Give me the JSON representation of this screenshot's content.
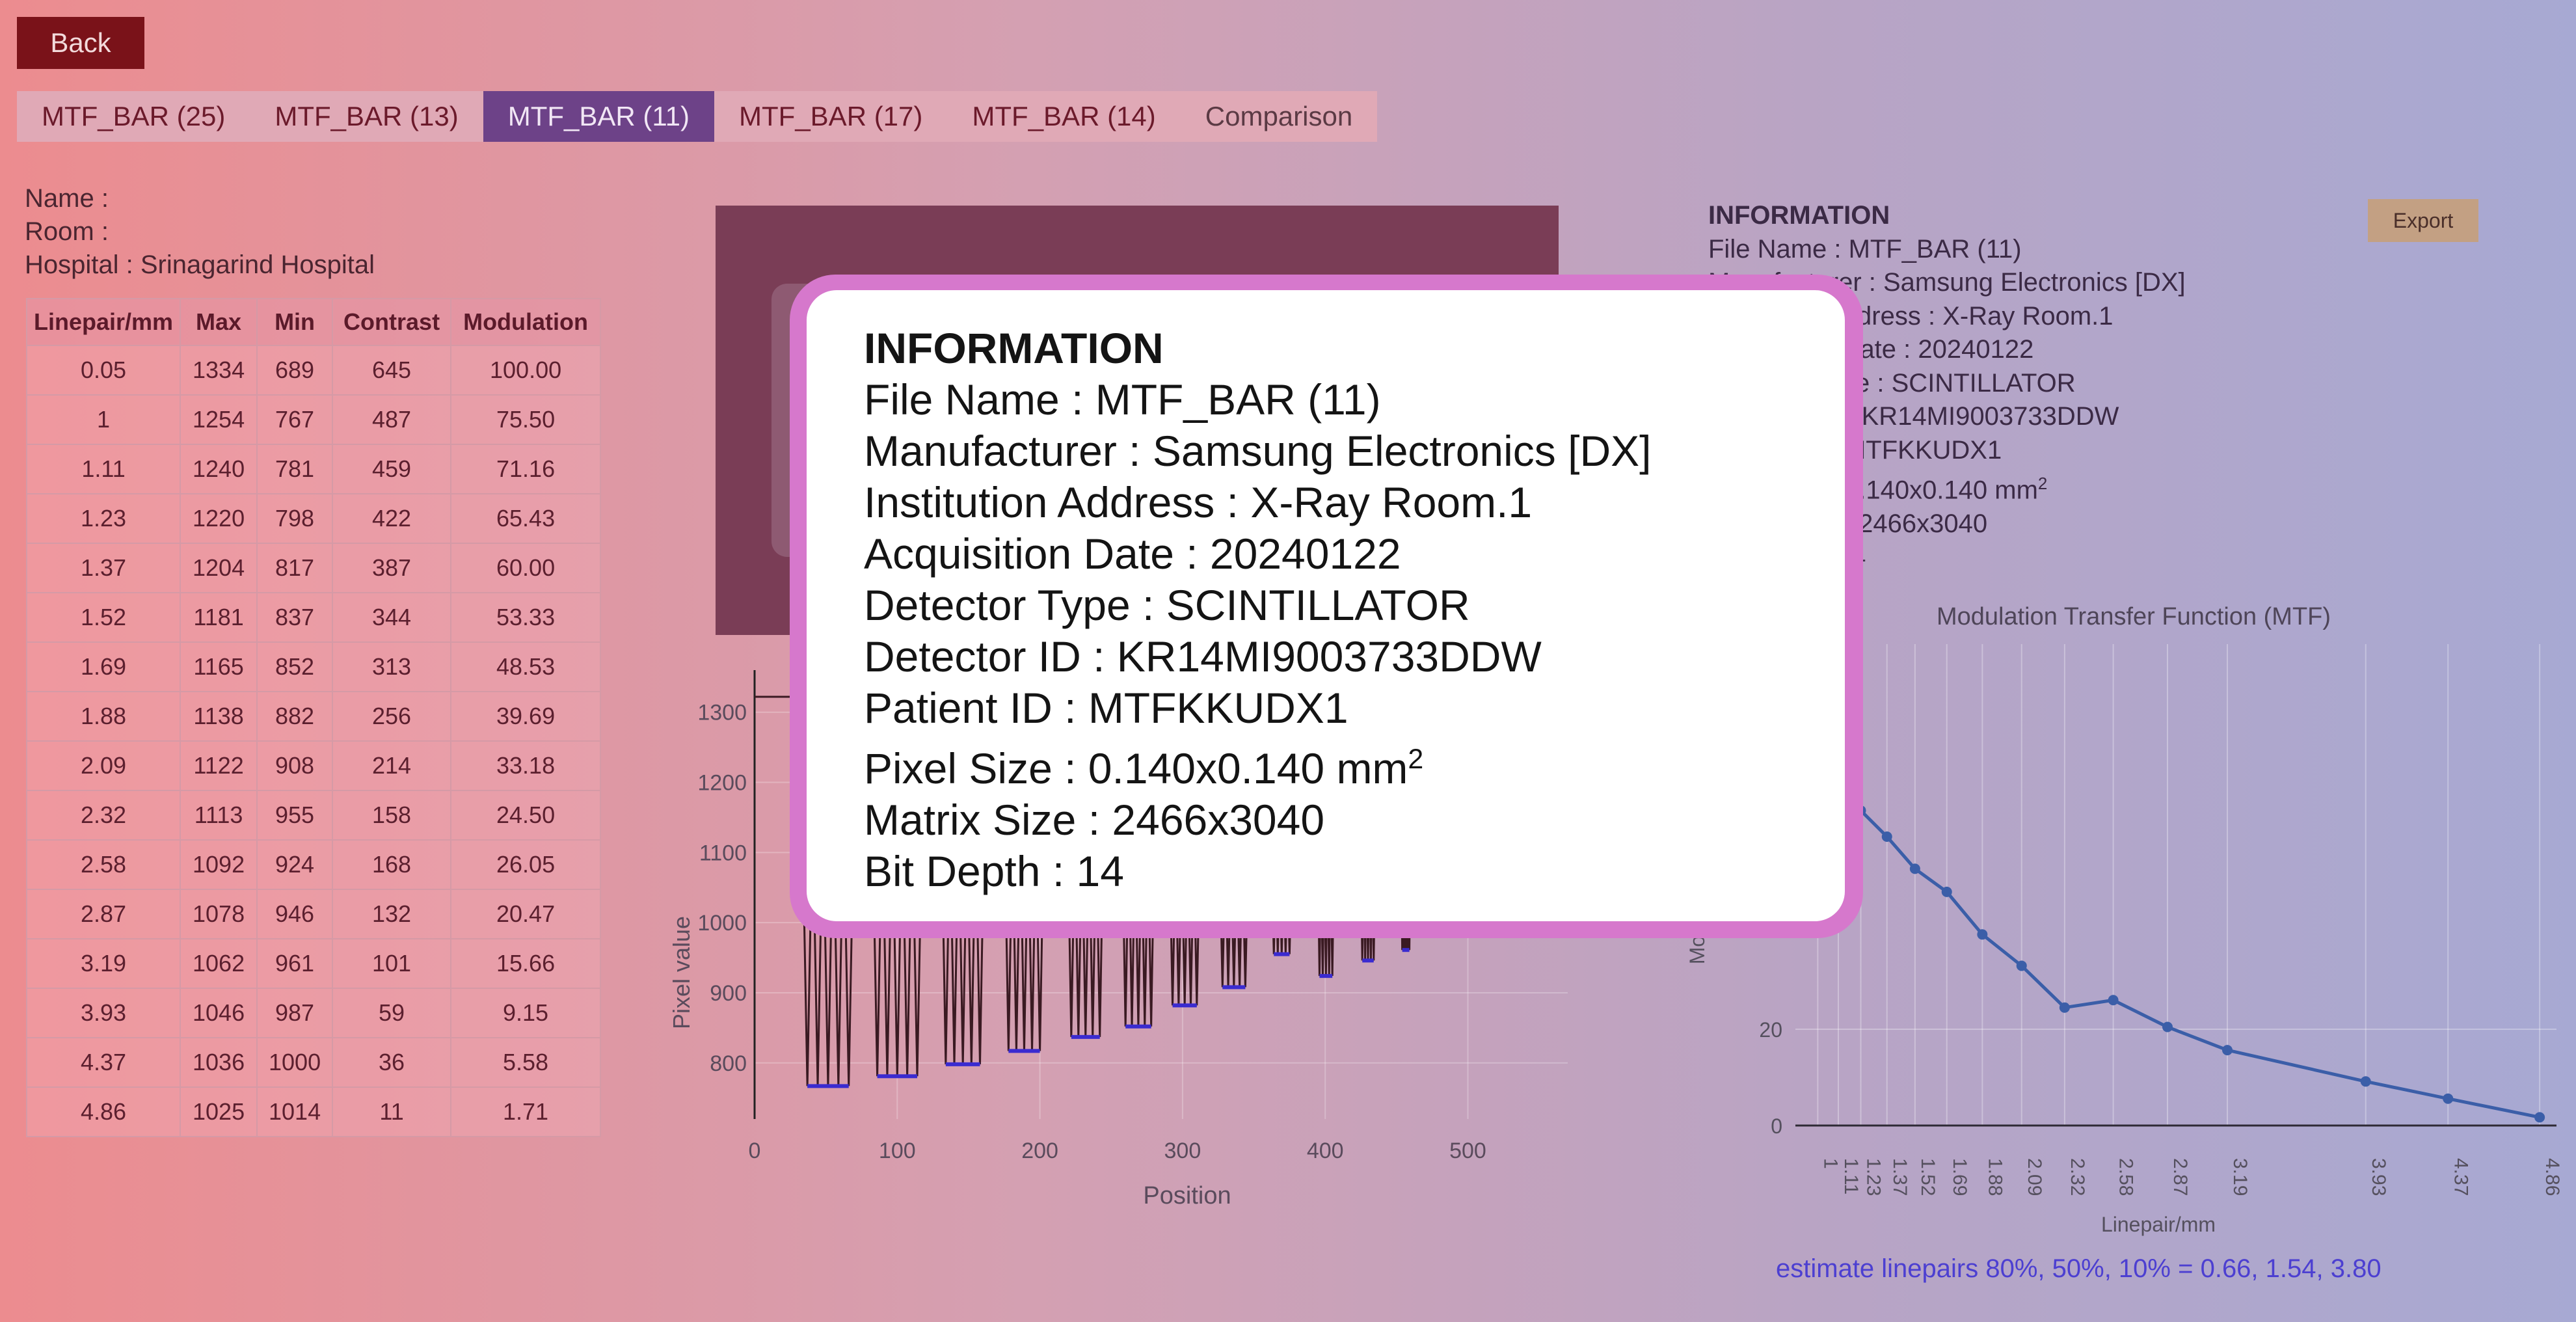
{
  "back_label": "Back",
  "tabs": [
    {
      "label": "MTF_BAR (25)",
      "active": false
    },
    {
      "label": "MTF_BAR (13)",
      "active": false
    },
    {
      "label": "MTF_BAR (11)",
      "active": true
    },
    {
      "label": "MTF_BAR (17)",
      "active": false
    },
    {
      "label": "MTF_BAR (14)",
      "active": false
    },
    {
      "label": "Comparison",
      "active": false
    }
  ],
  "patient": {
    "name": "Name :",
    "room": "Room :",
    "hospital": "Hospital : Srinagarind Hospital"
  },
  "table": {
    "headers": [
      "Linepair/mm",
      "Max",
      "Min",
      "Contrast",
      "Modulation"
    ],
    "rows": [
      [
        "0.05",
        "1334",
        "689",
        "645",
        "100.00"
      ],
      [
        "1",
        "1254",
        "767",
        "487",
        "75.50"
      ],
      [
        "1.11",
        "1240",
        "781",
        "459",
        "71.16"
      ],
      [
        "1.23",
        "1220",
        "798",
        "422",
        "65.43"
      ],
      [
        "1.37",
        "1204",
        "817",
        "387",
        "60.00"
      ],
      [
        "1.52",
        "1181",
        "837",
        "344",
        "53.33"
      ],
      [
        "1.69",
        "1165",
        "852",
        "313",
        "48.53"
      ],
      [
        "1.88",
        "1138",
        "882",
        "256",
        "39.69"
      ],
      [
        "2.09",
        "1122",
        "908",
        "214",
        "33.18"
      ],
      [
        "2.32",
        "1113",
        "955",
        "158",
        "24.50"
      ],
      [
        "2.58",
        "1092",
        "924",
        "168",
        "26.05"
      ],
      [
        "2.87",
        "1078",
        "946",
        "132",
        "20.47"
      ],
      [
        "3.19",
        "1062",
        "961",
        "101",
        "15.66"
      ],
      [
        "3.93",
        "1046",
        "987",
        "59",
        "9.15"
      ],
      [
        "4.37",
        "1036",
        "1000",
        "36",
        "5.58"
      ],
      [
        "4.86",
        "1025",
        "1014",
        "11",
        "1.71"
      ]
    ]
  },
  "info_panel": {
    "title": "INFORMATION",
    "file_name": "File Name : MTF_BAR (11)",
    "manufacturer": "Manufacturer : Samsung Electronics [DX]",
    "institution": "Institution Address : X-Ray Room.1",
    "acquisition": "Acquisition Date : 20240122",
    "detector_type": "Detector Type : SCINTILLATOR",
    "detector_id": "Detector ID : KR14MI9003733DDW",
    "patient_id": "Patient ID : MTFKKUDX1",
    "pixel_size": "Pixel Size : 0.140x0.140 mm",
    "pixel_size_sup": "2",
    "matrix_size": "Matrix Size : 2466x3040",
    "bit_depth": "Bit Depth : 14"
  },
  "export_label": "Export",
  "estimate_text": "estimate linepairs 80%, 50%, 10% = 0.66, 1.54, 3.80",
  "colors": {
    "back_button": "#7a1219",
    "active_tab": "#6d4288",
    "modal_border": "#d678cc",
    "mtf_line": "#3b5ea8",
    "profile_line": "#3a1a22",
    "min_marker": "#3a2bd0"
  },
  "chart_data": [
    {
      "type": "line",
      "title": "",
      "xlabel": "Position",
      "ylabel": "Pixel value",
      "xlim": [
        0,
        570
      ],
      "ylim": [
        720,
        1360
      ],
      "x_ticks": [
        0,
        100,
        200,
        300,
        400,
        500
      ],
      "y_ticks": [
        800,
        900,
        1000,
        1100,
        1200,
        1300
      ],
      "series": [
        {
          "values_visible_min_segments": [
            {
              "x": [
                37,
                66
              ],
              "y": 767
            },
            {
              "x": [
                86,
                114
              ],
              "y": 781
            },
            {
              "x": [
                134,
                158
              ],
              "y": 798
            },
            {
              "x": [
                178,
                200
              ],
              "y": 817
            },
            {
              "x": [
                222,
                242
              ],
              "y": 837
            },
            {
              "x": [
                260,
                278
              ],
              "y": 852
            },
            {
              "x": [
                293,
                310
              ],
              "y": 882
            },
            {
              "x": [
                328,
                344
              ],
              "y": 908
            },
            {
              "x": [
                364,
                375
              ],
              "y": 955
            },
            {
              "x": [
                396,
                405
              ],
              "y": 924
            },
            {
              "x": [
                426,
                434
              ],
              "y": 946
            },
            {
              "x": [
                454,
                459
              ],
              "y": 961
            }
          ]
        }
      ]
    },
    {
      "type": "line",
      "title": "Modulation Transfer Function (MTF)",
      "xlabel": "Linepair/mm",
      "ylabel": "Mo",
      "x_tick_labels": [
        "1",
        "1.11",
        "1.23",
        "1.37",
        "1.52",
        "1.69",
        "1.88",
        "2.09",
        "2.32",
        "2.58",
        "2.87",
        "3.19",
        "3.93",
        "4.37",
        "4.86"
      ],
      "y_ticks": [
        0,
        20
      ],
      "ylim": [
        0,
        100
      ],
      "x": [
        1,
        1.11,
        1.23,
        1.37,
        1.52,
        1.69,
        1.88,
        2.09,
        2.32,
        2.58,
        2.87,
        3.19,
        3.93,
        4.37,
        4.86
      ],
      "series": [
        {
          "values": [
            75.5,
            71.16,
            65.43,
            60.0,
            53.33,
            48.53,
            39.69,
            33.18,
            24.5,
            26.05,
            20.47,
            15.66,
            9.15,
            5.58,
            1.71
          ]
        }
      ]
    }
  ]
}
